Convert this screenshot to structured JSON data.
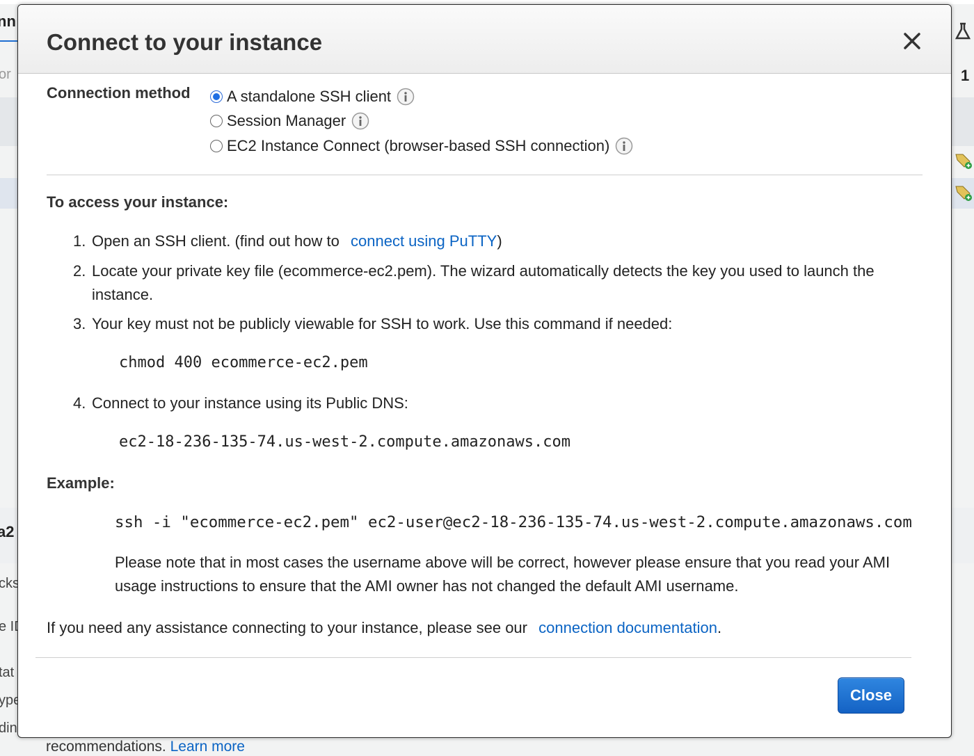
{
  "background": {
    "left_fragments": [
      "nn",
      "or",
      "a2",
      "cks",
      "e ID",
      "tat",
      "ype",
      "din"
    ],
    "right_fragments": [
      "1"
    ],
    "bottom_text": "recommendations.",
    "bottom_link": "Learn more"
  },
  "modal": {
    "title": "Connect to your instance",
    "close_icon": "close-icon",
    "connection_method": {
      "label": "Connection method",
      "options": [
        {
          "label": "A standalone SSH client",
          "selected": true
        },
        {
          "label": "Session Manager",
          "selected": false
        },
        {
          "label": "EC2 Instance Connect (browser-based SSH connection)",
          "selected": false
        }
      ]
    },
    "access_heading": "To access your instance:",
    "steps": [
      {
        "num": "1.",
        "text_before": "Open an SSH client. (find out how to",
        "link": "connect using PuTTY",
        "text_after": ")"
      },
      {
        "num": "2.",
        "text": "Locate your private key file (ecommerce-ec2.pem). The wizard automatically detects the key you used to launch the instance."
      },
      {
        "num": "3.",
        "text": "Your key must not be publicly viewable for SSH to work. Use this command if needed:",
        "code": "chmod 400 ecommerce-ec2.pem"
      },
      {
        "num": "4.",
        "text": "Connect to your instance using its Public DNS:",
        "code": "ec2-18-236-135-74.us-west-2.compute.amazonaws.com"
      }
    ],
    "example_heading": "Example:",
    "example_command": "ssh -i \"ecommerce-ec2.pem\" ec2-user@ec2-18-236-135-74.us-west-2.compute.amazonaws.com",
    "example_note": "Please note that in most cases the username above will be correct, however please ensure that you read your AMI usage instructions to ensure that the AMI owner has not changed the default AMI username.",
    "help": {
      "text_before": "If you need any assistance connecting to your instance, please see our",
      "link": "connection documentation",
      "text_after": "."
    },
    "close_button": "Close"
  },
  "colors": {
    "link": "#0b64c4",
    "primary_button": "#1f6fd1",
    "radio_selected": "#1f6fe3"
  }
}
